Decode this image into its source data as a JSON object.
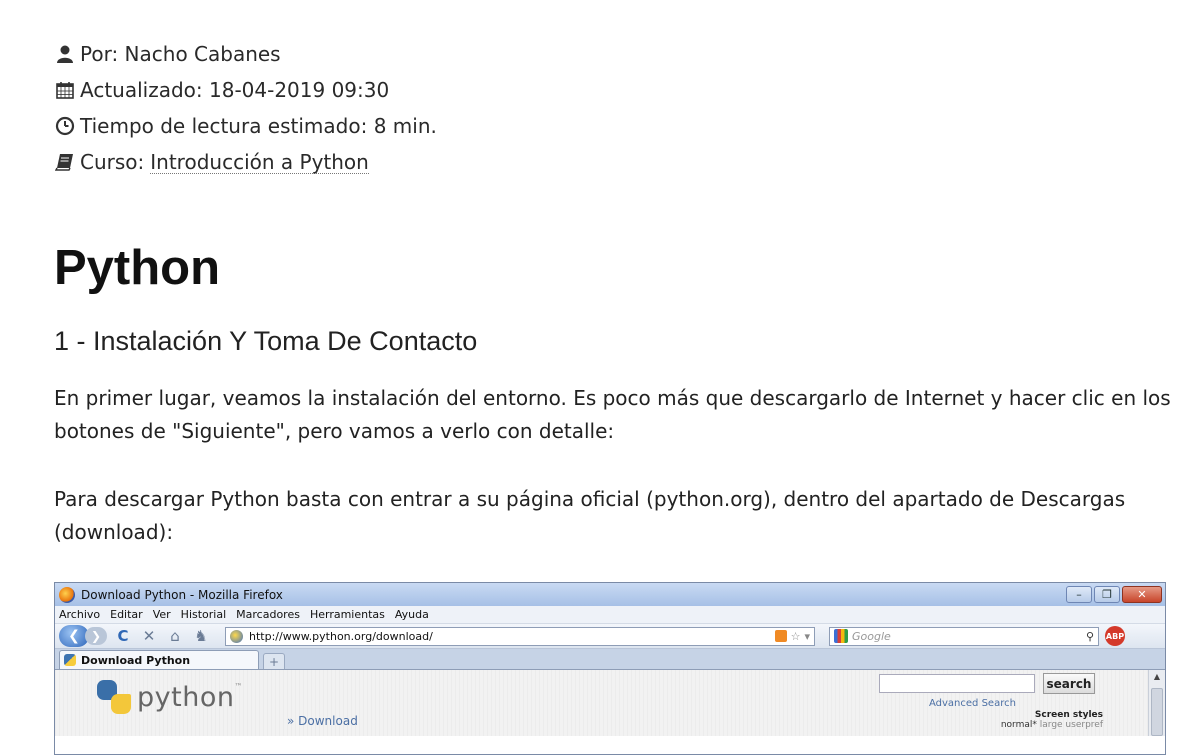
{
  "meta": {
    "author": "Por: Nacho Cabanes",
    "updated": "Actualizado: 18-04-2019 09:30",
    "reading_time": "Tiempo de lectura estimado: 8 min.",
    "course_prefix": "Curso:",
    "course_link": "Introducción a Python"
  },
  "article": {
    "title": "Python",
    "section": "1 - Instalación Y Toma De Contacto",
    "paragraph1": "En primer lugar, veamos la instalación del entorno. Es poco más que descargarlo de Internet y hacer clic en los botones de \"Siguiente\", pero vamos a verlo con detalle:",
    "paragraph2": "Para descargar Python basta con entrar a su página oficial (python.org), dentro del apartado de Descargas (download):"
  },
  "browser": {
    "window_title": "Download Python - Mozilla Firefox",
    "menu": [
      "Archivo",
      "Editar",
      "Ver",
      "Historial",
      "Marcadores",
      "Herramientas",
      "Ayuda"
    ],
    "url": "http://www.python.org/download/",
    "search_placeholder": "Google",
    "tab_label": "Download Python",
    "site": {
      "logo_text": "python",
      "logo_tm": "™",
      "breadcrumb": "» Download",
      "search_button": "search",
      "advanced_search": "Advanced Search",
      "screen_styles_title": "Screen styles",
      "screen_styles_selected": "normal*",
      "screen_styles_others": "large  userpref"
    }
  },
  "icons": {
    "user": "user-icon",
    "calendar": "calendar-icon",
    "clock": "clock-icon",
    "book": "book-icon"
  }
}
